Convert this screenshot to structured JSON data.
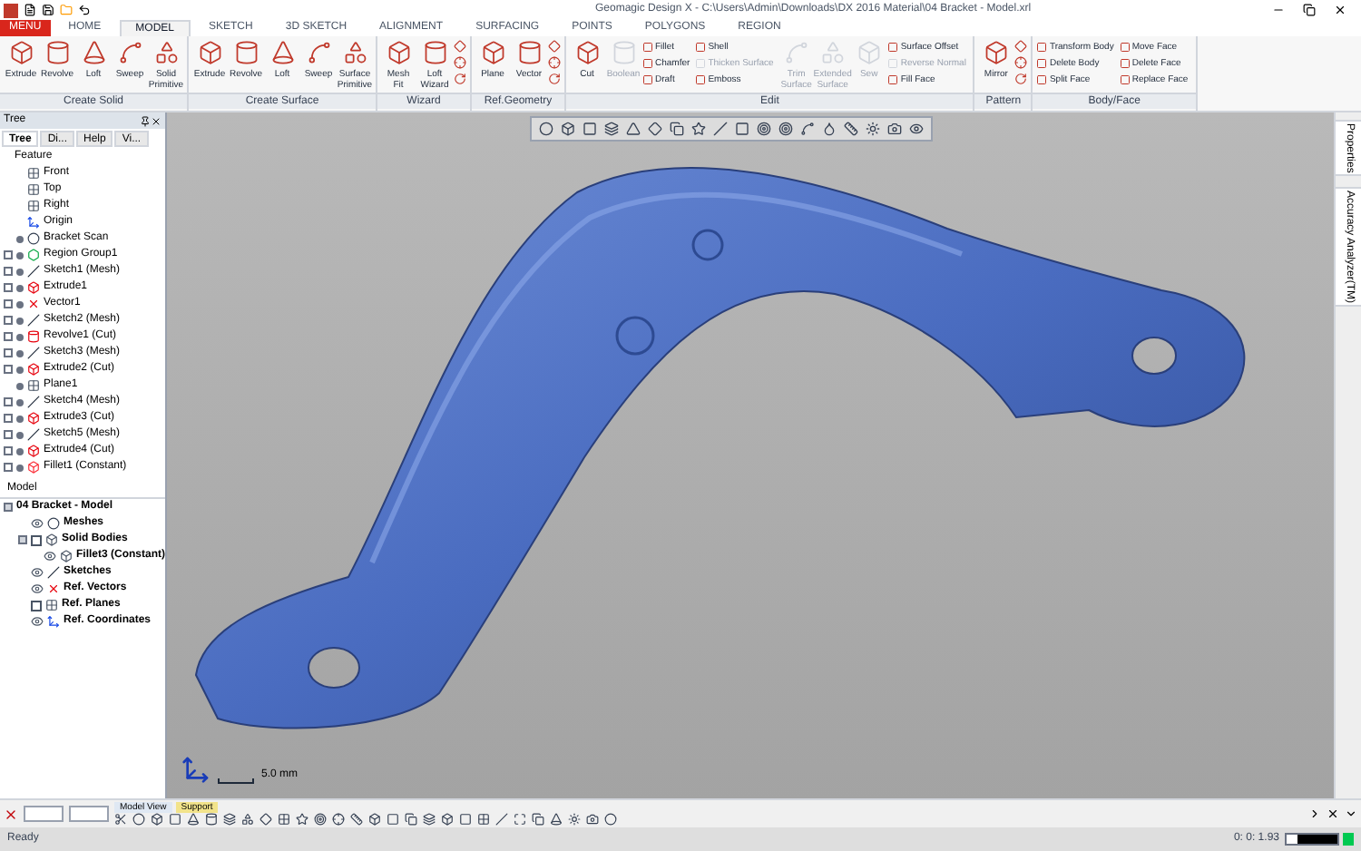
{
  "window": {
    "title": "Geomagic Design X - C:\\Users\\Admin\\Downloads\\DX 2016 Material\\04 Bracket - Model.xrl"
  },
  "menu_button": "MENU",
  "tabs": [
    {
      "label": "HOME",
      "selected": false
    },
    {
      "label": "MODEL",
      "selected": true
    },
    {
      "label": "SKETCH",
      "selected": false
    },
    {
      "label": "3D SKETCH",
      "selected": false
    },
    {
      "label": "ALIGNMENT",
      "selected": false
    },
    {
      "label": "SURFACING",
      "selected": false
    },
    {
      "label": "POINTS",
      "selected": false
    },
    {
      "label": "POLYGONS",
      "selected": false
    },
    {
      "label": "REGION",
      "selected": false
    }
  ],
  "ribbon": {
    "groups": [
      {
        "label": "Create Solid",
        "items": [
          {
            "kind": "large",
            "label": "Extrude",
            "disabled": false
          },
          {
            "kind": "large",
            "label": "Revolve",
            "disabled": false
          },
          {
            "kind": "large",
            "label": "Loft",
            "disabled": false
          },
          {
            "kind": "large",
            "label": "Sweep",
            "disabled": false
          },
          {
            "kind": "large",
            "label": "Solid Primitive",
            "disabled": false
          }
        ]
      },
      {
        "label": "Create Surface",
        "items": [
          {
            "kind": "large",
            "label": "Extrude",
            "disabled": false
          },
          {
            "kind": "large",
            "label": "Revolve",
            "disabled": false
          },
          {
            "kind": "large",
            "label": "Loft",
            "disabled": false
          },
          {
            "kind": "large",
            "label": "Sweep",
            "disabled": false
          },
          {
            "kind": "large",
            "label": "Surface Primitive",
            "disabled": false
          }
        ]
      },
      {
        "label": "Wizard",
        "items": [
          {
            "kind": "large",
            "label": "Mesh Fit",
            "disabled": false
          },
          {
            "kind": "large",
            "label": "Loft Wizard",
            "disabled": false
          },
          {
            "kind": "icons"
          }
        ]
      },
      {
        "label": "Ref.Geometry",
        "items": [
          {
            "kind": "large",
            "label": "Plane",
            "disabled": false
          },
          {
            "kind": "large",
            "label": "Vector",
            "disabled": false
          },
          {
            "kind": "icons"
          }
        ]
      },
      {
        "label": "Edit",
        "items": [
          {
            "kind": "large",
            "label": "Cut",
            "disabled": false
          },
          {
            "kind": "large",
            "label": "Boolean",
            "disabled": true
          },
          {
            "kind": "small",
            "label": "Fillet",
            "disabled": false
          },
          {
            "kind": "small",
            "label": "Chamfer",
            "disabled": false
          },
          {
            "kind": "small",
            "label": "Draft",
            "disabled": false
          },
          {
            "kind": "small",
            "label": "Shell",
            "disabled": false
          },
          {
            "kind": "small",
            "label": "Thicken Surface",
            "disabled": true
          },
          {
            "kind": "small",
            "label": "Emboss",
            "disabled": false
          },
          {
            "kind": "large",
            "label": "Trim Surface",
            "disabled": true
          },
          {
            "kind": "large",
            "label": "Extended Surface",
            "disabled": true
          },
          {
            "kind": "large",
            "label": "Sew",
            "disabled": true
          },
          {
            "kind": "small",
            "label": "Surface Offset",
            "disabled": false
          },
          {
            "kind": "small",
            "label": "Reverse Normal",
            "disabled": true
          },
          {
            "kind": "small",
            "label": "Fill Face",
            "disabled": false
          }
        ]
      },
      {
        "label": "Pattern",
        "items": [
          {
            "kind": "large",
            "label": "Mirror",
            "disabled": false
          },
          {
            "kind": "icons"
          }
        ]
      },
      {
        "label": "Body/Face",
        "items": [
          {
            "kind": "small",
            "label": "Transform Body",
            "disabled": false
          },
          {
            "kind": "small",
            "label": "Delete Body",
            "disabled": false
          },
          {
            "kind": "small",
            "label": "Split Face",
            "disabled": false
          },
          {
            "kind": "small",
            "label": "Move Face",
            "disabled": false
          },
          {
            "kind": "small",
            "label": "Delete Face",
            "disabled": false
          },
          {
            "kind": "small",
            "label": "Replace Face",
            "disabled": false
          }
        ]
      }
    ]
  },
  "tree_panel": {
    "title": "Tree",
    "tabs": [
      {
        "label": "Tree",
        "selected": true
      },
      {
        "label": "Di...",
        "selected": false
      },
      {
        "label": "Help",
        "selected": false
      },
      {
        "label": "Vi...",
        "selected": false
      }
    ],
    "feature_label": "Feature",
    "features": [
      {
        "name": "Front",
        "kind": "plane",
        "collapsible": false,
        "visible": false
      },
      {
        "name": "Top",
        "kind": "plane",
        "collapsible": false,
        "visible": false
      },
      {
        "name": "Right",
        "kind": "plane",
        "collapsible": false,
        "visible": false
      },
      {
        "name": "Origin",
        "kind": "origin",
        "collapsible": false,
        "visible": false
      },
      {
        "name": "Bracket Scan",
        "kind": "scan",
        "collapsible": false,
        "visible": true
      },
      {
        "name": "Region Group1",
        "kind": "region",
        "collapsible": true,
        "visible": true
      },
      {
        "name": "Sketch1 (Mesh)",
        "kind": "sketch",
        "collapsible": true,
        "visible": true
      },
      {
        "name": "Extrude1",
        "kind": "extrude",
        "collapsible": true,
        "visible": true
      },
      {
        "name": "Vector1",
        "kind": "vector",
        "collapsible": true,
        "visible": true
      },
      {
        "name": "Sketch2 (Mesh)",
        "kind": "sketch",
        "collapsible": true,
        "visible": true
      },
      {
        "name": "Revolve1 (Cut)",
        "kind": "revolve",
        "collapsible": true,
        "visible": true
      },
      {
        "name": "Sketch3 (Mesh)",
        "kind": "sketch",
        "collapsible": true,
        "visible": true
      },
      {
        "name": "Extrude2 (Cut)",
        "kind": "extrude",
        "collapsible": true,
        "visible": true
      },
      {
        "name": "Plane1",
        "kind": "plane",
        "collapsible": false,
        "visible": true
      },
      {
        "name": "Sketch4 (Mesh)",
        "kind": "sketch",
        "collapsible": true,
        "visible": true
      },
      {
        "name": "Extrude3 (Cut)",
        "kind": "extrude",
        "collapsible": true,
        "visible": true
      },
      {
        "name": "Sketch5 (Mesh)",
        "kind": "sketch",
        "collapsible": true,
        "visible": true
      },
      {
        "name": "Extrude4 (Cut)",
        "kind": "extrude",
        "collapsible": true,
        "visible": true
      },
      {
        "name": "Fillet1 (Constant)",
        "kind": "fillet",
        "collapsible": true,
        "visible": true
      }
    ],
    "model_label": "Model",
    "model": {
      "name": "04 Bracket - Model",
      "expanded": true,
      "children": [
        {
          "name": "Meshes",
          "kind": "mesh",
          "visible": true
        },
        {
          "name": "Solid Bodies",
          "kind": "body",
          "visible": false,
          "expanded": true,
          "children": [
            {
              "name": "Fillet3 (Constant)",
              "kind": "body",
              "visible": true
            }
          ]
        },
        {
          "name": "Sketches",
          "kind": "sketch",
          "visible": true
        },
        {
          "name": "Ref. Vectors",
          "kind": "vector",
          "visible": true
        },
        {
          "name": "Ref. Planes",
          "kind": "plane",
          "visible": false
        },
        {
          "name": "Ref. Coordinates",
          "kind": "origin",
          "visible": true
        }
      ]
    }
  },
  "viewport": {
    "scale_label": "5.0 mm"
  },
  "side_tabs": [
    {
      "label": "Properties"
    },
    {
      "label": "Accuracy Analyzer(TM)"
    }
  ],
  "bottom_toolbar": {
    "tabs": [
      {
        "label": "Model View",
        "selected": true
      },
      {
        "label": "Support",
        "selected": false
      }
    ]
  },
  "status_bar": {
    "message": "Ready",
    "time": "0: 0: 1.93",
    "level": 0.8
  }
}
